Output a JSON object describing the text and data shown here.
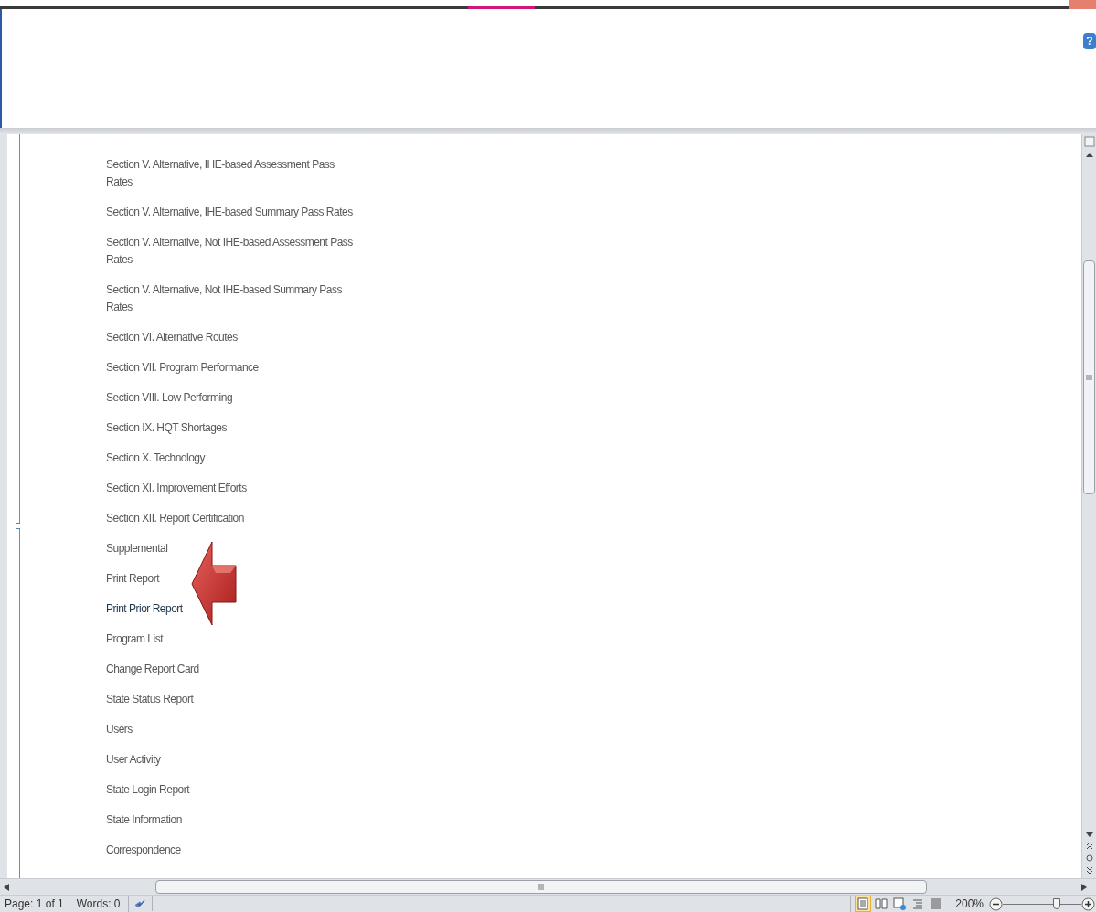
{
  "ribbon": {
    "help_glyph": "?"
  },
  "document": {
    "links": [
      {
        "label": "Section V. Alternative, IHE-based Assessment Pass Rates",
        "selected": false
      },
      {
        "label": "Section V. Alternative, IHE-based Summary Pass Rates",
        "selected": false
      },
      {
        "label": "Section V. Alternative, Not IHE-based Assessment Pass Rates",
        "selected": false
      },
      {
        "label": "Section V. Alternative, Not IHE-based Summary Pass Rates",
        "selected": false
      },
      {
        "label": "Section VI. Alternative Routes",
        "selected": false
      },
      {
        "label": "Section VII. Program Performance",
        "selected": false
      },
      {
        "label": "Section VIII. Low Performing",
        "selected": false
      },
      {
        "label": "Section IX. HQT Shortages",
        "selected": false
      },
      {
        "label": "Section X. Technology",
        "selected": false
      },
      {
        "label": "Section XI. Improvement Efforts",
        "selected": false
      },
      {
        "label": "Section XII. Report Certification",
        "selected": false
      },
      {
        "label": "Supplemental",
        "selected": false
      },
      {
        "label": "Print Report",
        "selected": false
      },
      {
        "label": "Print Prior Report",
        "selected": true
      },
      {
        "label": "Program List",
        "selected": false
      },
      {
        "label": "Change Report Card",
        "selected": false
      },
      {
        "label": "State Status Report",
        "selected": false
      },
      {
        "label": "Users",
        "selected": false
      },
      {
        "label": "User Activity",
        "selected": false
      },
      {
        "label": "State Login Report",
        "selected": false
      },
      {
        "label": "State Information",
        "selected": false
      },
      {
        "label": "Correspondence",
        "selected": false
      }
    ]
  },
  "status_bar": {
    "page": "Page: 1 of 1",
    "words": "Words: 0",
    "views": [
      {
        "kind": "print",
        "selected": true
      },
      {
        "kind": "reading",
        "selected": false
      },
      {
        "kind": "web",
        "selected": false
      },
      {
        "kind": "outline",
        "selected": false
      },
      {
        "kind": "draft",
        "selected": false
      }
    ],
    "zoom": {
      "reading": "200%",
      "level": 0.7
    }
  }
}
